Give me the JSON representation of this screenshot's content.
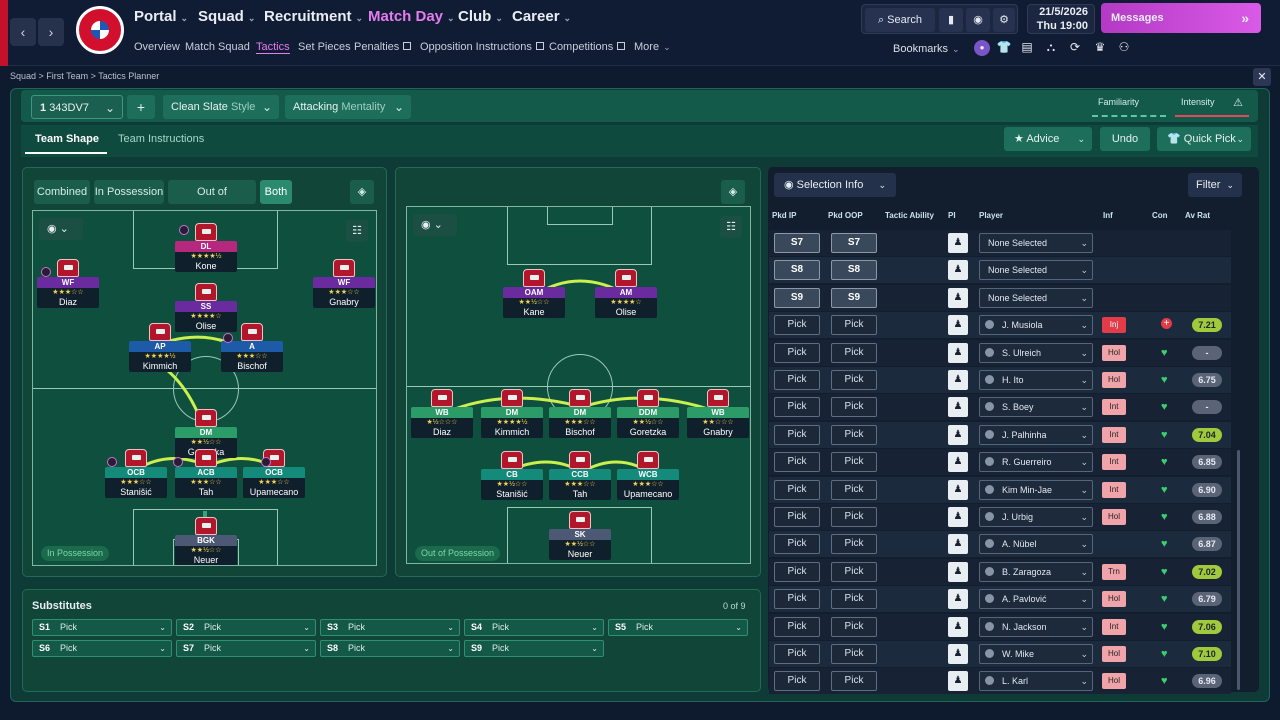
{
  "nav": {
    "main": [
      "Portal",
      "Squad",
      "Recruitment",
      "Match Day",
      "Club",
      "Career"
    ],
    "sub": [
      "Overview",
      "Match Squad",
      "Tactics",
      "Set Pieces",
      "Penalties",
      "Opposition Instructions",
      "Competitions",
      "More"
    ],
    "search": "Search",
    "date": "21/5/2026",
    "time": "Thu  19:00",
    "messages": "Messages",
    "bookmarks": "Bookmarks",
    "crest_text": "FC BAYERN MÜNCHEN"
  },
  "breadcrumb": [
    "Squad",
    "First Team",
    "Tactics Planner"
  ],
  "toolbar": {
    "tactic_num": "1",
    "tactic_name": "343DV7",
    "style_value": "Clean Slate",
    "style_label": "Style",
    "mentality_value": "Attacking",
    "mentality_label": "Mentality",
    "familiarity": "Familiarity",
    "intensity": "Intensity"
  },
  "tabs": {
    "shape": "Team Shape",
    "instructions": "Team Instructions",
    "advice": "Advice",
    "undo": "Undo",
    "quick_pick": "Quick Pick"
  },
  "modes": [
    "Combined",
    "In Possession",
    "Out of Possession",
    "Both"
  ],
  "pitch_left": {
    "label": "In Possession",
    "players": [
      {
        "role": "DL",
        "sub": "F",
        "name": "Kone",
        "stars": "★★★★½",
        "color": "r-pink"
      },
      {
        "role": "WF",
        "sub": "F",
        "name": "Diaz",
        "stars": "★★★☆☆",
        "color": "r-purple"
      },
      {
        "role": "SS",
        "sub": "",
        "name": "Olise",
        "stars": "★★★★☆",
        "color": "r-purple"
      },
      {
        "role": "WF",
        "sub": "D",
        "name": "Gnabry",
        "stars": "★★★☆☆",
        "color": "r-purple"
      },
      {
        "role": "AP",
        "sub": "",
        "name": "Kimmich",
        "stars": "★★★★½",
        "color": "r-blue"
      },
      {
        "role": "A",
        "sub": "",
        "name": "Bischof",
        "stars": "★★★☆☆",
        "color": "r-blue"
      },
      {
        "role": "DM",
        "sub": "",
        "name": "Goretzka",
        "stars": "★★½☆☆",
        "color": "r-green"
      },
      {
        "role": "OCB",
        "sub": "",
        "name": "Stanišić",
        "stars": "★★★☆☆",
        "color": "r-teal"
      },
      {
        "role": "ACB",
        "sub": "",
        "name": "Tah",
        "stars": "★★★☆☆",
        "color": "r-teal"
      },
      {
        "role": "OCB",
        "sub": "",
        "name": "Upamecano",
        "stars": "★★★☆☆",
        "color": "r-teal"
      },
      {
        "role": "BGK",
        "sub": "",
        "name": "Neuer",
        "stars": "★★½☆☆",
        "color": "r-slate"
      }
    ]
  },
  "pitch_right": {
    "label": "Out of Possession",
    "players": [
      {
        "role": "OAM",
        "name": "Kane",
        "stars": "★★½☆☆",
        "color": "r-purple"
      },
      {
        "role": "AM",
        "name": "Olise",
        "stars": "★★★★☆",
        "color": "r-purple"
      },
      {
        "role": "WB",
        "name": "Diaz",
        "stars": "★½☆☆☆",
        "color": "r-green"
      },
      {
        "role": "DM",
        "name": "Kimmich",
        "stars": "★★★★½",
        "color": "r-green"
      },
      {
        "role": "DM",
        "name": "Bischof",
        "stars": "★★★☆☆",
        "color": "r-green"
      },
      {
        "role": "DDM",
        "name": "Goretzka",
        "stars": "★★½☆☆",
        "color": "r-green"
      },
      {
        "role": "WB",
        "name": "Gnabry",
        "stars": "★★☆☆☆",
        "color": "r-green"
      },
      {
        "role": "CB",
        "name": "Stanišić",
        "stars": "★★½☆☆",
        "color": "r-teal"
      },
      {
        "role": "CCB",
        "name": "Tah",
        "stars": "★★★☆☆",
        "color": "r-teal"
      },
      {
        "role": "WCB",
        "name": "Upamecano",
        "stars": "★★★☆☆",
        "color": "r-teal"
      },
      {
        "role": "SK",
        "name": "Neuer",
        "stars": "★★½☆☆",
        "color": "r-slate"
      }
    ]
  },
  "substitutes": {
    "title": "Substitutes",
    "count": "0 of 9",
    "slots": [
      {
        "slot": "S1",
        "value": "Pick"
      },
      {
        "slot": "S2",
        "value": "Pick"
      },
      {
        "slot": "S3",
        "value": "Pick"
      },
      {
        "slot": "S4",
        "value": "Pick"
      },
      {
        "slot": "S5",
        "value": "Pick"
      },
      {
        "slot": "S6",
        "value": "Pick"
      },
      {
        "slot": "S7",
        "value": "Pick"
      },
      {
        "slot": "S8",
        "value": "Pick"
      },
      {
        "slot": "S9",
        "value": "Pick"
      }
    ]
  },
  "selection": {
    "info_label": "Selection Info",
    "filter_label": "Filter",
    "headers": [
      "Pkd IP",
      "Pkd OOP",
      "Tactic Ability",
      "PI",
      "Player",
      "Inf",
      "Con",
      "Av Rat"
    ],
    "rows": [
      {
        "ip": "S7",
        "oop": "S7",
        "player": "None Selected",
        "inf": "",
        "con": "",
        "rat": "",
        "sel": true
      },
      {
        "ip": "S8",
        "oop": "S8",
        "player": "None Selected",
        "inf": "",
        "con": "",
        "rat": "",
        "sel": true
      },
      {
        "ip": "S9",
        "oop": "S9",
        "player": "None Selected",
        "inf": "",
        "con": "",
        "rat": "",
        "sel": true
      },
      {
        "ip": "Pick",
        "oop": "Pick",
        "player": "J. Musiola",
        "inf": "Inj",
        "con": "+",
        "rat": "7.21",
        "good": true
      },
      {
        "ip": "Pick",
        "oop": "Pick",
        "player": "S. Ulreich",
        "inf": "Hol",
        "con": "♥",
        "rat": "-"
      },
      {
        "ip": "Pick",
        "oop": "Pick",
        "player": "H. Ito",
        "inf": "Hol",
        "con": "♥",
        "rat": "6.75"
      },
      {
        "ip": "Pick",
        "oop": "Pick",
        "player": "S. Boey",
        "inf": "Int",
        "con": "♥",
        "rat": "-"
      },
      {
        "ip": "Pick",
        "oop": "Pick",
        "player": "J. Palhinha",
        "inf": "Int",
        "con": "♥",
        "rat": "7.04",
        "good": true
      },
      {
        "ip": "Pick",
        "oop": "Pick",
        "player": "R. Guerreiro",
        "inf": "Int",
        "con": "♥",
        "rat": "6.85"
      },
      {
        "ip": "Pick",
        "oop": "Pick",
        "player": "Kim Min-Jae",
        "inf": "Int",
        "con": "♥",
        "rat": "6.90"
      },
      {
        "ip": "Pick",
        "oop": "Pick",
        "player": "J. Urbig",
        "inf": "Hol",
        "con": "♥",
        "rat": "6.88"
      },
      {
        "ip": "Pick",
        "oop": "Pick",
        "player": "A. Nübel",
        "inf": "",
        "con": "♥",
        "rat": "6.87"
      },
      {
        "ip": "Pick",
        "oop": "Pick",
        "player": "B. Zaragoza",
        "inf": "Trn",
        "con": "♥",
        "rat": "7.02",
        "good": true
      },
      {
        "ip": "Pick",
        "oop": "Pick",
        "player": "A. Pavlović",
        "inf": "Hol",
        "con": "♥",
        "rat": "6.79"
      },
      {
        "ip": "Pick",
        "oop": "Pick",
        "player": "N. Jackson",
        "inf": "Int",
        "con": "♥",
        "rat": "7.06",
        "good": true
      },
      {
        "ip": "Pick",
        "oop": "Pick",
        "player": "W. Mike",
        "inf": "Hol",
        "con": "♥",
        "rat": "7.10",
        "good": true
      },
      {
        "ip": "Pick",
        "oop": "Pick",
        "player": "L. Karl",
        "inf": "Hol",
        "con": "♥",
        "rat": "6.96"
      }
    ]
  }
}
